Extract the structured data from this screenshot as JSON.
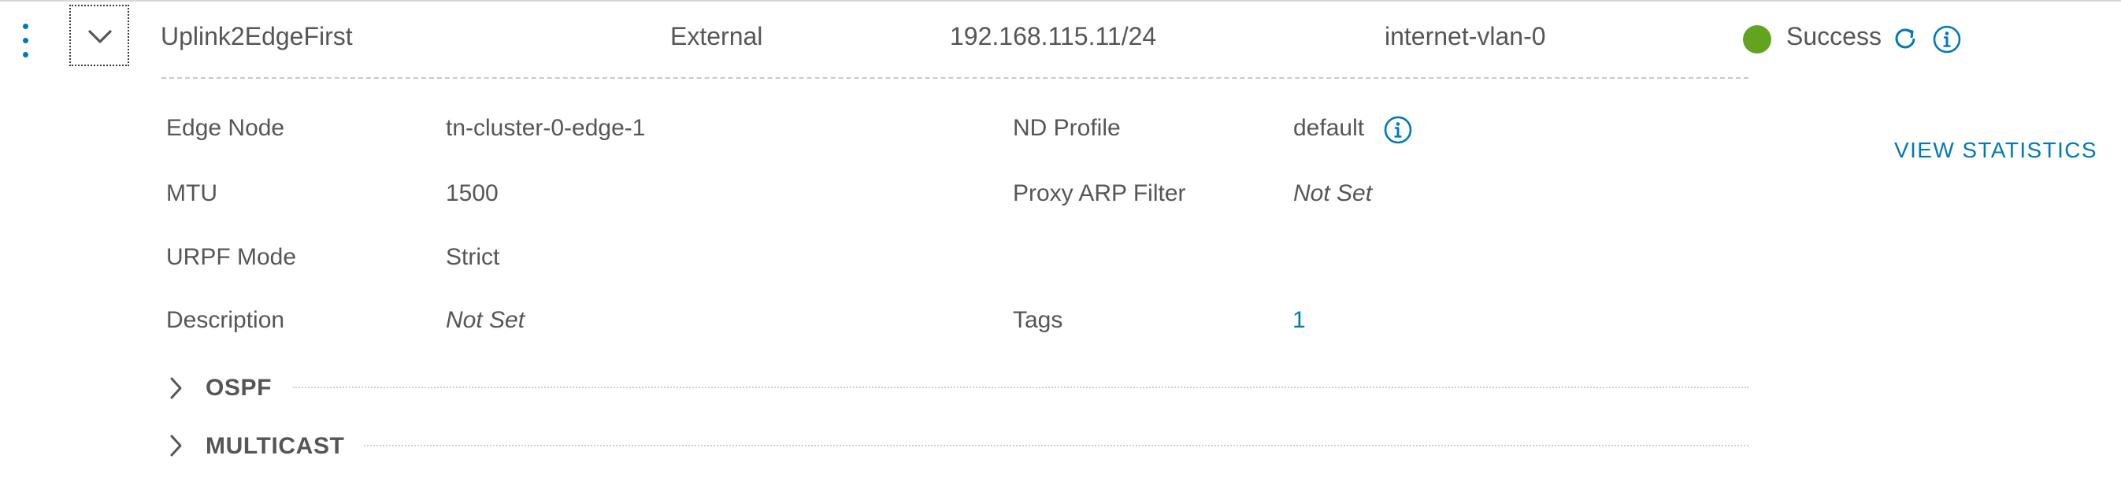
{
  "row": {
    "name": "Uplink2EdgeFirst",
    "type": "External",
    "ip": "192.168.115.11/24",
    "segment": "internet-vlan-0",
    "status": "Success",
    "status_color": "#62a420"
  },
  "details": {
    "edge_node_label": "Edge Node",
    "edge_node_value": "tn-cluster-0-edge-1",
    "mtu_label": "MTU",
    "mtu_value": "1500",
    "urpf_label": "URPF Mode",
    "urpf_value": "Strict",
    "description_label": "Description",
    "description_value": "Not Set",
    "nd_profile_label": "ND Profile",
    "nd_profile_value": "default",
    "proxy_arp_label": "Proxy ARP Filter",
    "proxy_arp_value": "Not Set",
    "tags_label": "Tags",
    "tags_value": "1"
  },
  "actions": {
    "view_statistics": "VIEW STATISTICS"
  },
  "sections": {
    "ospf": "OSPF",
    "multicast": "MULTICAST"
  },
  "icons": {
    "kebab": "kebab-menu-icon",
    "expand": "chevron-down-icon",
    "refresh": "refresh-icon",
    "info": "info-icon",
    "section_toggle": "chevron-right-icon"
  },
  "colors": {
    "accent": "#0079b8",
    "text": "#565656",
    "success": "#62a420"
  }
}
